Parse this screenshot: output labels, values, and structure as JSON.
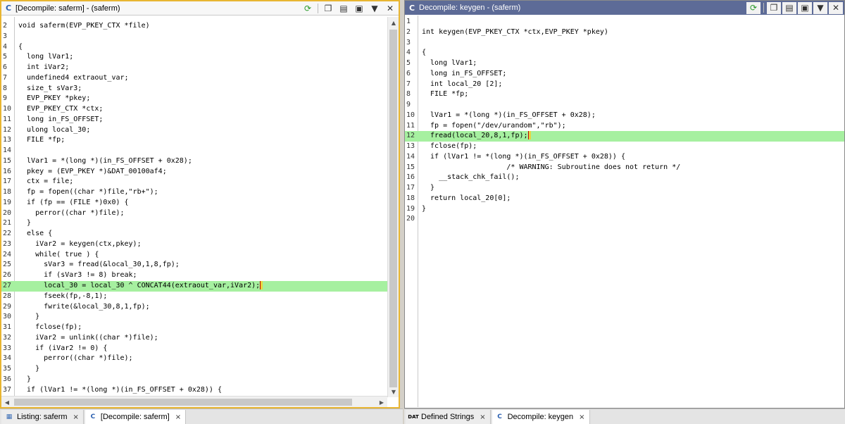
{
  "left": {
    "title": "[Decompile: saferm] -  (saferm)",
    "icons": [
      "refresh-icon",
      "copy-icon",
      "snapshot-icon",
      "camera-icon",
      "menu-icon",
      "close-icon"
    ],
    "highlight_line": 27,
    "lines": [
      {
        "n": "2",
        "t": "void saferm(EVP_PKEY_CTX *file)"
      },
      {
        "n": "3",
        "t": ""
      },
      {
        "n": "4",
        "t": "{"
      },
      {
        "n": "5",
        "t": "  long lVar1;"
      },
      {
        "n": "6",
        "t": "  int iVar2;"
      },
      {
        "n": "7",
        "t": "  undefined4 extraout_var;"
      },
      {
        "n": "8",
        "t": "  size_t sVar3;"
      },
      {
        "n": "9",
        "t": "  EVP_PKEY *pkey;"
      },
      {
        "n": "10",
        "t": "  EVP_PKEY_CTX *ctx;"
      },
      {
        "n": "11",
        "t": "  long in_FS_OFFSET;"
      },
      {
        "n": "12",
        "t": "  ulong local_30;"
      },
      {
        "n": "13",
        "t": "  FILE *fp;"
      },
      {
        "n": "14",
        "t": ""
      },
      {
        "n": "15",
        "t": "  lVar1 = *(long *)(in_FS_OFFSET + 0x28);"
      },
      {
        "n": "16",
        "t": "  pkey = (EVP_PKEY *)&DAT_00100af4;"
      },
      {
        "n": "17",
        "t": "  ctx = file;"
      },
      {
        "n": "18",
        "t": "  fp = fopen((char *)file,\"rb+\");"
      },
      {
        "n": "19",
        "t": "  if (fp == (FILE *)0x0) {"
      },
      {
        "n": "20",
        "t": "    perror((char *)file);"
      },
      {
        "n": "21",
        "t": "  }"
      },
      {
        "n": "22",
        "t": "  else {"
      },
      {
        "n": "23",
        "t": "    iVar2 = keygen(ctx,pkey);"
      },
      {
        "n": "24",
        "t": "    while( true ) {"
      },
      {
        "n": "25",
        "t": "      sVar3 = fread(&local_30,1,8,fp);"
      },
      {
        "n": "26",
        "t": "      if (sVar3 != 8) break;"
      },
      {
        "n": "27",
        "t": "      local_30 = local_30 ^ CONCAT44(extraout_var,iVar2);"
      },
      {
        "n": "28",
        "t": "      fseek(fp,-8,1);"
      },
      {
        "n": "29",
        "t": "      fwrite(&local_30,8,1,fp);"
      },
      {
        "n": "30",
        "t": "    }"
      },
      {
        "n": "31",
        "t": "    fclose(fp);"
      },
      {
        "n": "32",
        "t": "    iVar2 = unlink((char *)file);"
      },
      {
        "n": "33",
        "t": "    if (iVar2 != 0) {"
      },
      {
        "n": "34",
        "t": "      perror((char *)file);"
      },
      {
        "n": "35",
        "t": "    }"
      },
      {
        "n": "36",
        "t": "  }"
      },
      {
        "n": "37",
        "t": "  if (lVar1 != *(long *)(in_FS_OFFSET + 0x28)) {"
      }
    ]
  },
  "right": {
    "title": "Decompile: keygen -  (saferm)",
    "highlight_line": 12,
    "lines": [
      {
        "n": "1",
        "t": ""
      },
      {
        "n": "2",
        "t": "int keygen(EVP_PKEY_CTX *ctx,EVP_PKEY *pkey)"
      },
      {
        "n": "3",
        "t": ""
      },
      {
        "n": "4",
        "t": "{"
      },
      {
        "n": "5",
        "t": "  long lVar1;"
      },
      {
        "n": "6",
        "t": "  long in_FS_OFFSET;"
      },
      {
        "n": "7",
        "t": "  int local_20 [2];"
      },
      {
        "n": "8",
        "t": "  FILE *fp;"
      },
      {
        "n": "9",
        "t": ""
      },
      {
        "n": "10",
        "t": "  lVar1 = *(long *)(in_FS_OFFSET + 0x28);"
      },
      {
        "n": "11",
        "t": "  fp = fopen(\"/dev/urandom\",\"rb\");"
      },
      {
        "n": "12",
        "t": "  fread(local_20,8,1,fp);"
      },
      {
        "n": "13",
        "t": "  fclose(fp);"
      },
      {
        "n": "14",
        "t": "  if (lVar1 != *(long *)(in_FS_OFFSET + 0x28)) {"
      },
      {
        "n": "15",
        "t": "                    /* WARNING: Subroutine does not return */"
      },
      {
        "n": "16",
        "t": "    __stack_chk_fail();"
      },
      {
        "n": "17",
        "t": "  }"
      },
      {
        "n": "18",
        "t": "  return local_20[0];"
      },
      {
        "n": "19",
        "t": "}"
      },
      {
        "n": "20",
        "t": ""
      }
    ]
  },
  "left_tabs": [
    {
      "label": "Listing: saferm",
      "icon": "listing-icon",
      "active": false
    },
    {
      "label": "[Decompile: saferm]",
      "icon": "decompile-icon",
      "active": true
    }
  ],
  "right_tabs": [
    {
      "label": "Defined Strings",
      "icon": "strings-icon",
      "active": false
    },
    {
      "label": "Decompile: keygen",
      "icon": "decompile-icon",
      "active": true
    }
  ],
  "colors": {
    "active_border": "#e8b531",
    "right_titlebar": "#5d6b97",
    "highlight": "#a6f0a0"
  }
}
